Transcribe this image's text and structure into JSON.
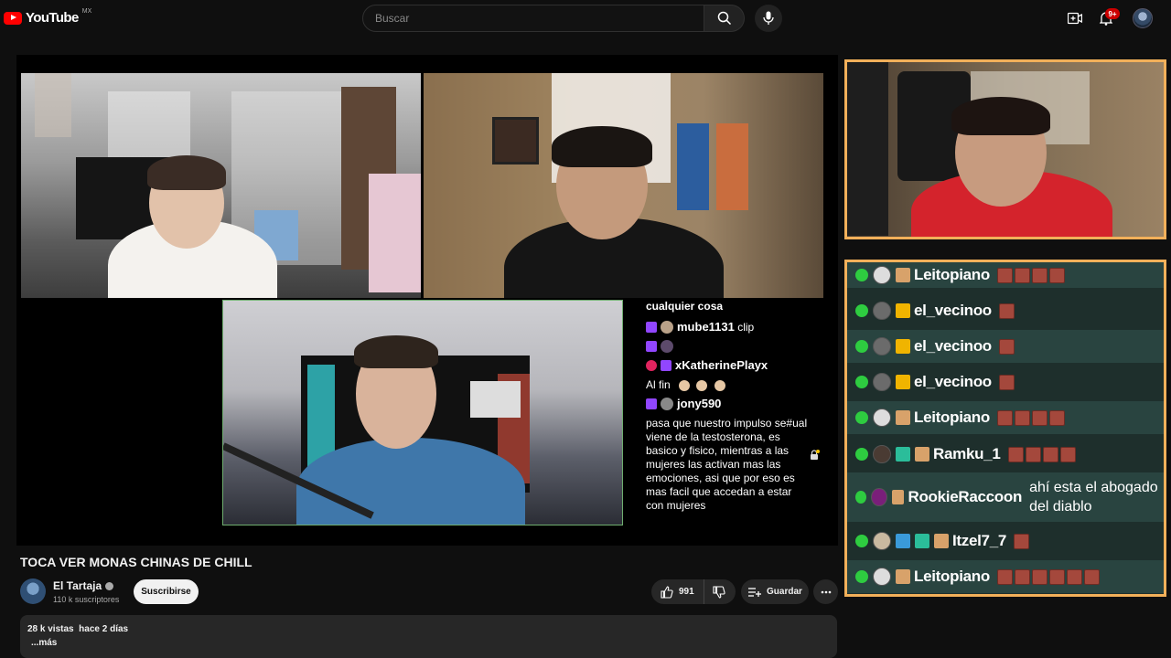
{
  "header": {
    "logo_text": "YouTube",
    "country_code": "MX",
    "search_placeholder": "Buscar",
    "notification_count": "9+"
  },
  "stream_overlay_chat": {
    "top_text": "cualquier cosa",
    "lines": [
      {
        "user": "mube1131",
        "text": "clip"
      },
      {
        "user": "",
        "text": ""
      },
      {
        "user": "xKatherinePlayx",
        "text": ""
      },
      {
        "user": "",
        "text": "Al fin"
      },
      {
        "user": "jony590",
        "text": ""
      }
    ],
    "last_message": "pasa que nuestro impulso se#ual viene de la testosterona, es basico y fisico, mientras a las mujeres las activan mas las emociones, asi que por eso es mas facil que accedan a estar con mujeres"
  },
  "side_chat": {
    "rows": [
      {
        "name": "Leitopiano",
        "emotes": 4,
        "message": ""
      },
      {
        "name": "el_vecinoo",
        "emotes": 1,
        "message": ""
      },
      {
        "name": "el_vecinoo",
        "emotes": 1,
        "message": ""
      },
      {
        "name": "el_vecinoo",
        "emotes": 1,
        "message": ""
      },
      {
        "name": "Leitopiano",
        "emotes": 4,
        "message": ""
      },
      {
        "name": "Ramku_1",
        "emotes": 4,
        "message": ""
      },
      {
        "name": "RookieRaccoon",
        "emotes": 0,
        "message": "ahí esta el abogado del diablo"
      },
      {
        "name": "Itzel7_7",
        "emotes": 1,
        "message": ""
      },
      {
        "name": "Leitopiano",
        "emotes": 6,
        "message": ""
      }
    ]
  },
  "video": {
    "title": "TOCA VER MONAS CHINAS DE CHILL",
    "channel_name": "El Tartaja",
    "subscribers": "110 k suscriptores",
    "subscribe_label": "Suscribirse",
    "likes": "991",
    "save_label": "Guardar",
    "views": "28 k vistas",
    "published": "hace 2 días",
    "more_label": "...más"
  },
  "colors": {
    "brand_red": "#ff0000",
    "frame_orange": "#f2b05a",
    "twitch_purple": "#9146ff",
    "badge_green": "#2ecc40"
  }
}
